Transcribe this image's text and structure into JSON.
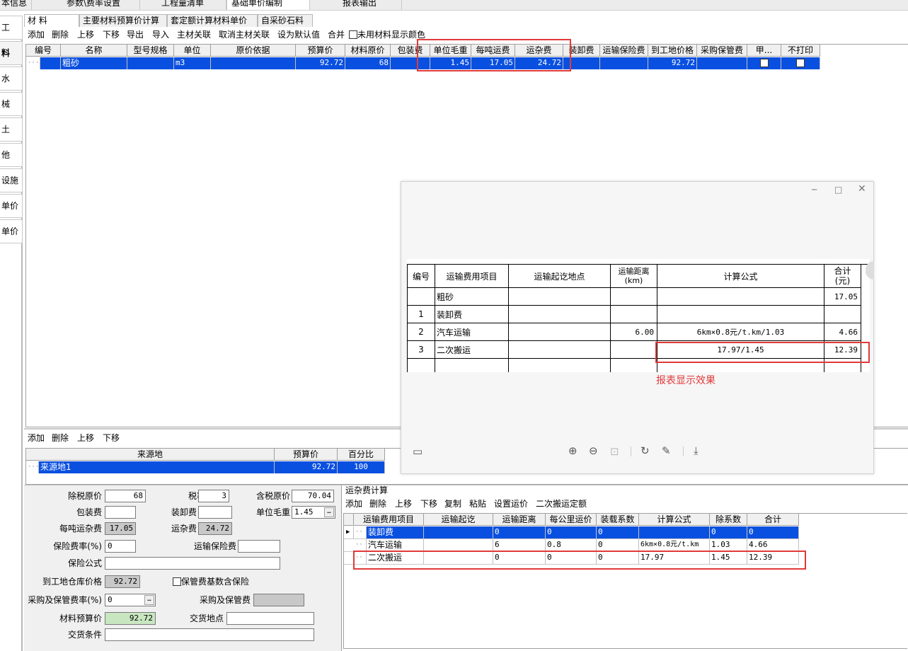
{
  "top_tabs": [
    "本信息",
    "参数\\费率设置",
    "工程量清单",
    "基础单价编制",
    "报表输出"
  ],
  "left_nav": [
    "工",
    "料",
    "水",
    "械",
    "土",
    "他",
    "设施",
    "单价",
    "单价"
  ],
  "main_tabs": [
    "材 料",
    "主要材料预算价计算",
    "套定额计算材料单价",
    "自采砂石料"
  ],
  "toolbar1": {
    "items": [
      "添加",
      "删除",
      "上移",
      "下移",
      "导出",
      "导入",
      "主材关联",
      "取消主材关联",
      "设为默认值",
      "合并"
    ],
    "checkbox_label": "未用材料显示颜色"
  },
  "material_grid": {
    "headers": [
      "编号",
      "名称",
      "型号规格",
      "单位",
      "原价依据",
      "预算价",
      "材料原价",
      "包装费",
      "单位毛重",
      "每吨运费",
      "运杂费",
      "装卸费",
      "运输保险费",
      "到工地价格",
      "采购保管费",
      "甲...",
      "不打印"
    ],
    "row": {
      "name": "粗砂",
      "unit": "m3",
      "budget": "92.72",
      "orig": "68",
      "gross": "1.45",
      "freight": "17.05",
      "misc": "24.72",
      "site": "92.72"
    }
  },
  "toolbar2": [
    "添加",
    "删除",
    "上移",
    "下移"
  ],
  "source_grid": {
    "headers": [
      "来源地",
      "预算价",
      "百分比"
    ],
    "row": {
      "name": "来源地1",
      "price": "92.72",
      "pct": "100"
    }
  },
  "form": {
    "excl_tax_label": "除税原价",
    "excl_tax": "68",
    "tax_rate_label": "税率",
    "tax_rate": "3",
    "incl_tax_label": "含税原价",
    "incl_tax": "70.04",
    "packing_label": "包装费",
    "packing": "",
    "loading_label": "装卸费",
    "loading": "",
    "gross_label": "单位毛重",
    "gross": "1.45",
    "per_ton_label": "每吨运杂费",
    "per_ton": "17.05",
    "misc_label": "运杂费",
    "misc": "24.72",
    "ins_rate_label": "保险费率(%)",
    "ins_rate": "0",
    "trans_ins_label": "运输保险费",
    "trans_ins": "",
    "ins_formula_label": "保险公式",
    "ins_formula": "",
    "warehouse_label": "到工地仓库价格",
    "warehouse": "92.72",
    "ins_base_label": "保管费基数含保险",
    "purchase_rate_label": "采购及保管费率(%)",
    "purchase_rate": "0",
    "purchase_fee_label": "采购及保管费",
    "purchase_fee": "",
    "budget_label": "材料预算价",
    "budget": "92.72",
    "place_label": "交货地点",
    "place": "",
    "condition_label": "交货条件",
    "condition": ""
  },
  "freight_panel": {
    "title": "运杂费计算",
    "toolbar": [
      "添加",
      "删除",
      "上移",
      "下移",
      "复制",
      "粘贴",
      "设置运价",
      "二次搬运定额"
    ],
    "headers": [
      "运输费用项目",
      "运输起讫",
      "运输距离",
      "每公里运价",
      "装载系数",
      "计算公式",
      "除系数",
      "合计"
    ],
    "rows": [
      {
        "item": "装卸费",
        "from": "",
        "dist": "0",
        "price": "0",
        "load": "0",
        "formula": "",
        "div": "0",
        "total": "0"
      },
      {
        "item": "汽车运输",
        "from": "",
        "dist": "6",
        "price": "0.8",
        "load": "0",
        "formula": "6km×0.8元/t.km",
        "div": "1.03",
        "total": "4.66"
      },
      {
        "item": "二次搬运",
        "from": "",
        "dist": "0",
        "price": "0",
        "load": "0",
        "formula": "17.97",
        "div": "1.45",
        "total": "12.39"
      }
    ]
  },
  "report": {
    "headers": [
      "编号",
      "运输费用项目",
      "运输起讫地点",
      "运输距离\n(km)",
      "计算公式",
      "合计\n(元)"
    ],
    "rows": [
      {
        "no": "",
        "item": "粗砂",
        "place": "",
        "dist": "",
        "formula": "",
        "total": "17.05"
      },
      {
        "no": "1",
        "item": "装卸费",
        "place": "",
        "dist": "",
        "formula": "",
        "total": ""
      },
      {
        "no": "2",
        "item": "汽车运输",
        "place": "",
        "dist": "6.00",
        "formula": "6km×0.8元/t.km/1.03",
        "total": "4.66"
      },
      {
        "no": "3",
        "item": "二次搬运",
        "place": "",
        "dist": "",
        "formula": "17.97/1.45",
        "total": "12.39"
      }
    ],
    "caption": "报表显示效果"
  },
  "colors": {
    "selection": "#0a50e0",
    "annotation": "#e03a3a"
  }
}
